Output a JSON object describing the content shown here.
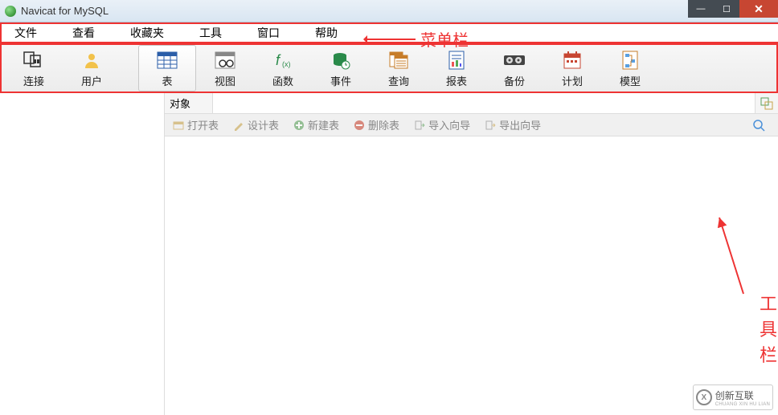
{
  "window": {
    "title": "Navicat for MySQL"
  },
  "menu": {
    "items": [
      "文件",
      "查看",
      "收藏夹",
      "工具",
      "窗口",
      "帮助"
    ],
    "annotation": "菜单栏"
  },
  "toolbar": {
    "items": [
      {
        "label": "连接",
        "icon": "plug"
      },
      {
        "label": "用户",
        "icon": "user"
      },
      {
        "label": "表",
        "icon": "table",
        "active": true
      },
      {
        "label": "视图",
        "icon": "view"
      },
      {
        "label": "函数",
        "icon": "fx"
      },
      {
        "label": "事件",
        "icon": "event"
      },
      {
        "label": "查询",
        "icon": "query"
      },
      {
        "label": "报表",
        "icon": "report"
      },
      {
        "label": "备份",
        "icon": "backup"
      },
      {
        "label": "计划",
        "icon": "schedule"
      },
      {
        "label": "模型",
        "icon": "model"
      }
    ],
    "annotation": "工具栏"
  },
  "object_tab": {
    "label": "对象"
  },
  "object_tools": {
    "items": [
      "打开表",
      "设计表",
      "新建表",
      "删除表",
      "导入向导",
      "导出向导"
    ]
  },
  "watermark": {
    "brand": "创新互联",
    "sub": "CHUANG XIN HU LIAN",
    "badge": "X"
  }
}
